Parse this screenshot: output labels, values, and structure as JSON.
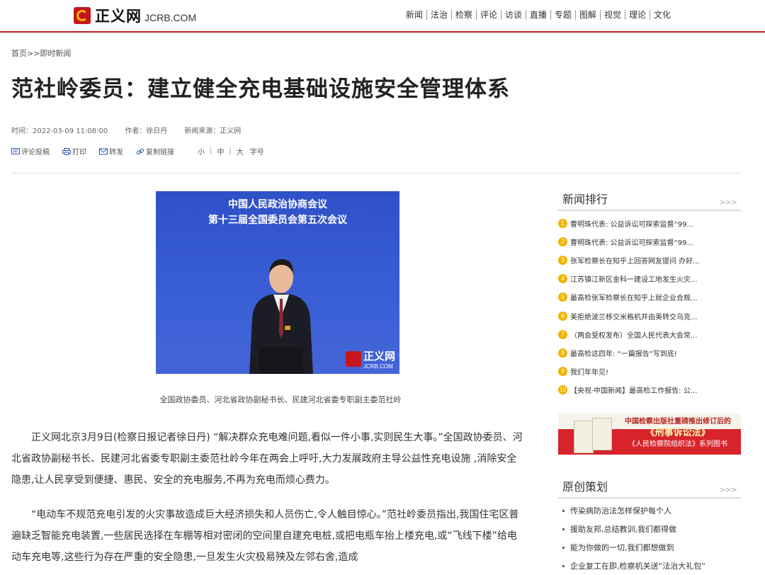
{
  "header": {
    "logo_text": "正义网",
    "logo_domain": "JCRB.COM",
    "nav": [
      "新闻",
      "法治",
      "检察",
      "评论",
      "访谈",
      "直播",
      "专题",
      "图解",
      "视觉",
      "理论",
      "文化"
    ]
  },
  "breadcrumb": "首页>>即时新闻",
  "article": {
    "title": "范社岭委员：建立健全充电基础设施安全管理体系",
    "time": "时间：2022-03-09 11:08:00",
    "author": "作者：徐日丹",
    "source": "新闻来源：正义网",
    "tools": {
      "comment": "评论投稿",
      "print": "打印",
      "forward": "转发",
      "copy": "复制链接"
    },
    "font_sizes": {
      "small": "小",
      "medium": "中",
      "large": "大",
      "label": "字号"
    },
    "photo": {
      "line1": "中国人民政治协商会议",
      "line2": "第十三届全国委员会第五次会议",
      "watermark": "正义网",
      "watermark_domain": "JCRB.COM"
    },
    "caption": "全国政协委员、河北省政协副秘书长、民建河北省委专职副主委范社岭",
    "paragraphs": [
      "正义网北京3月9日(检察日报记者徐日丹) “解决群众充电难问题,看似一件小事,实则民生大事。”全国政协委员、河北省政协副秘书长、民建河北省委专职副主委范社岭今年在两会上呼吁,大力发展政府主导公益性充电设施 ,消除安全隐患,让人民享受到便捷、惠民、安全的充电服务,不再为充电而烦心费力。",
      "“电动车不规范充电引发的火灾事故造成巨大经济损失和人员伤亡,令人触目惊心。”范社岭委员指出,我国住宅区普遍缺乏智能充电装置,一些居民选择在车棚等相对密闭的空间里自建充电桩,或把电瓶车抬上楼充电,或“飞线下楼”给电动车充电等,这些行为存在严重的安全隐患,一旦发生火灾极易殃及左邻右舍,造成"
    ]
  },
  "sidebar": {
    "ranking_title": "新闻排行",
    "ranking_more": ">>>",
    "ranking": [
      {
        "num": "1",
        "text": "曹明珠代表: 公益诉讼可探索监督“99..."
      },
      {
        "num": "2",
        "text": "曹明珠代表: 公益诉讼可探索监督“99..."
      },
      {
        "num": "3",
        "text": "张军检察长在知乎上回答网友提问 办好..."
      },
      {
        "num": "4",
        "text": "江苏镇江新区金科一建设工地发生火灾..."
      },
      {
        "num": "5",
        "text": "最高检张军检察长在知乎上就企业合规..."
      },
      {
        "num": "6",
        "text": "美拒绝波兰移交米格机并由美转交乌克..."
      },
      {
        "num": "7",
        "text": "（两会受权发布）全国人民代表大会常..."
      },
      {
        "num": "8",
        "text": "最高检这四年: “一篇报告”写到底!"
      },
      {
        "num": "9",
        "text": "我们年年见!"
      },
      {
        "num": "10",
        "text": "【央视·中国新闻】最高检工作报告: 公..."
      }
    ],
    "banner": {
      "line1": "中国检察出版社重磅推出修订后的",
      "line2": "《刑事诉讼法》",
      "line3": "《人民检察院组织法》系列图书"
    },
    "plan_title": "原创策划",
    "plan_more": ">>>",
    "plans": [
      "传染病防治法怎样保护每个人",
      "援助友邦,总结教训,我们都得做",
      "能为你做的一切,我们都想做到",
      "企业复工在即,检察机关送“法治大礼包”"
    ]
  }
}
